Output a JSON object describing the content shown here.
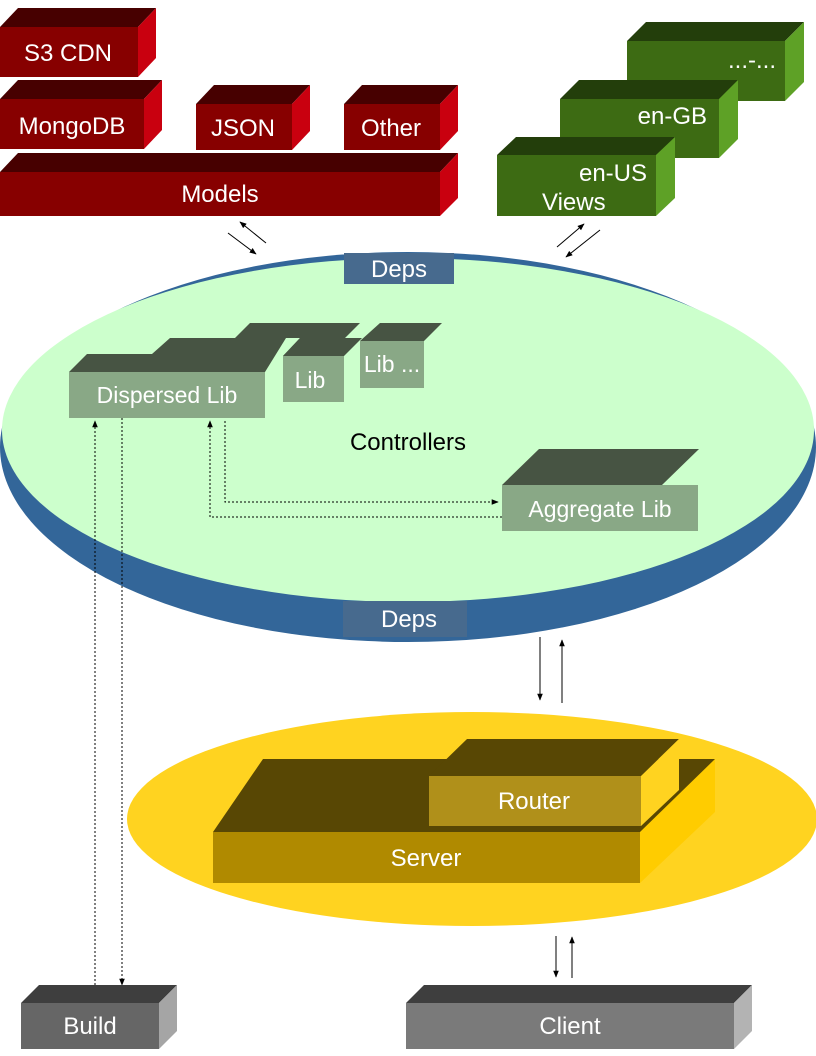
{
  "diagram": {
    "models_group": {
      "boxes": [
        {
          "id": "s3cdn",
          "label": "S3 CDN"
        },
        {
          "id": "mongodb",
          "label": "MongoDB"
        },
        {
          "id": "json",
          "label": "JSON"
        },
        {
          "id": "other",
          "label": "Other"
        },
        {
          "id": "models",
          "label": "Models"
        }
      ],
      "colors": {
        "front": "#870000",
        "top": "#470000",
        "side": "#c9000f"
      }
    },
    "views_group": {
      "boxes": [
        {
          "id": "more-locales",
          "label": "...-..."
        },
        {
          "id": "en-gb",
          "label": "en-GB"
        },
        {
          "id": "en-us",
          "label": "en-US"
        }
      ],
      "caption": "Views",
      "colors": {
        "front": "#3d6b13",
        "top": "#233e0b",
        "side": "#5ea126"
      }
    },
    "controllers_group": {
      "label": "Controllers",
      "deps_top": "Deps",
      "deps_bottom": "Deps",
      "libs": [
        {
          "id": "dispersed-lib",
          "label": "Dispersed Lib"
        },
        {
          "id": "lib",
          "label": "Lib"
        },
        {
          "id": "lib-more",
          "label": "Lib ..."
        },
        {
          "id": "aggregate-lib",
          "label": "Aggregate Lib"
        }
      ],
      "colors": {
        "ring": "#336699",
        "fill": "#ccffcc",
        "deps_badge": "#476a8e",
        "lib_front": "#89a886",
        "lib_top": "#475443"
      }
    },
    "server_group": {
      "router": "Router",
      "server": "Server",
      "colors": {
        "ellipse": "#ffd320",
        "front": "#b08a00",
        "top": "#584704",
        "side": "#ffcc00",
        "router_front": "#b0901a"
      }
    },
    "build": {
      "label": "Build"
    },
    "client": {
      "label": "Client"
    }
  }
}
